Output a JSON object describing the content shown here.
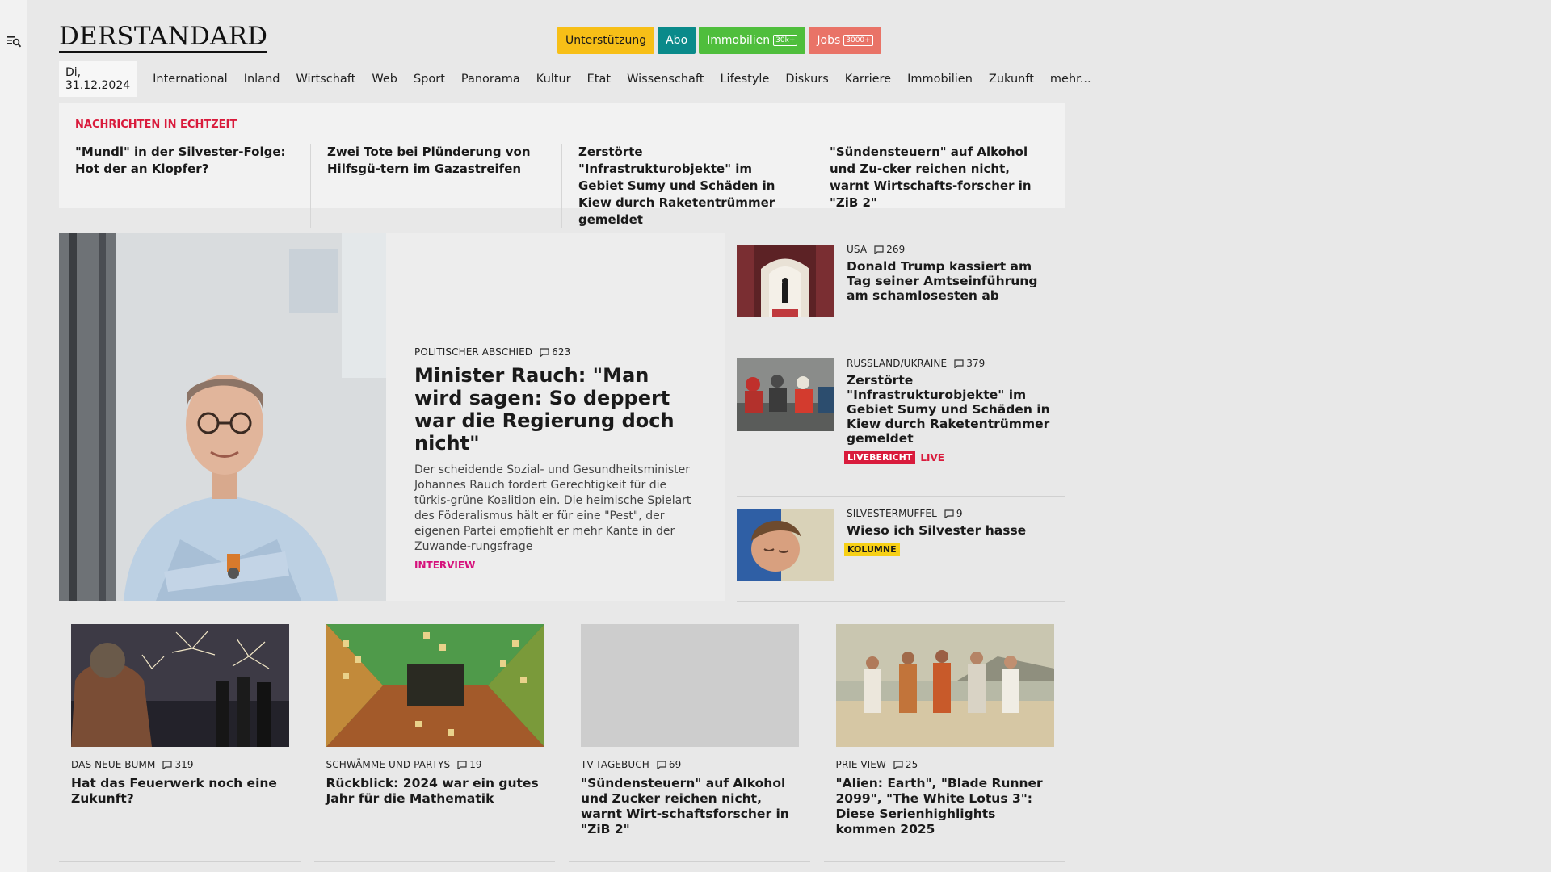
{
  "header": {
    "logo": "DERSTANDARD",
    "buttons": {
      "support": "Unterstützung",
      "abo": "Abo",
      "immo": "Immobilien",
      "immo_badge": "30k+",
      "jobs": "Jobs",
      "jobs_badge": "3000+"
    }
  },
  "nav": {
    "date": "Di, 31.12.2024",
    "items": [
      "International",
      "Inland",
      "Wirtschaft",
      "Web",
      "Sport",
      "Panorama",
      "Kultur",
      "Etat",
      "Wissenschaft",
      "Lifestyle",
      "Diskurs",
      "Karriere",
      "Immobilien",
      "Zukunft",
      "mehr..."
    ]
  },
  "live": {
    "label": "NACHRICHTEN IN ECHTZEIT",
    "items": [
      "\"Mundl\" in der Silvester-Folge: Hot der an Klopfer?",
      "Zwei Tote bei Plünderung von Hilfsgü-tern im Gazastreifen",
      "Zerstörte \"Infrastrukturobjekte\" im Gebiet Sumy und Schäden in Kiew durch Raketentrümmer gemeldet",
      "\"Sündensteuern\" auf Alkohol und Zu-cker reichen nicht, warnt Wirtschafts-forscher in \"ZiB 2\""
    ]
  },
  "hero": {
    "kicker": "Politischer Abschied",
    "comments": "623",
    "title": "Minister Rauch: \"Man wird sagen: So deppert war die Regierung doch nicht\"",
    "lead": "Der scheidende Sozial- und Gesundheitsminister Johannes Rauch fordert Gerechtigkeit für die türkis-grüne Koalition ein. Die heimische Spielart des Föderalismus hält er für eine \"Pest\", der eigenen Partei empfiehlt er mehr Kante in der Zuwande-rungsfrage",
    "tag": "Interview"
  },
  "side": [
    {
      "kicker": "USA",
      "comments": "269",
      "title": "Donald Trump kassiert am Tag seiner Amtseinführung am schamlosesten ab"
    },
    {
      "kicker": "Russland/Ukraine",
      "comments": "379",
      "title": "Zerstörte \"Infrastrukturobjekte\" im Gebiet Sumy und Schäden in Kiew durch Raketentrümmer gemeldet",
      "tag": "Livebericht",
      "live": "Live"
    },
    {
      "kicker": "Silvestermuffel",
      "comments": "9",
      "title": "Wieso ich Silvester hasse",
      "tag": "Kolumne"
    }
  ],
  "cards": [
    {
      "kicker": "Das neue Bumm",
      "comments": "319",
      "title": "Hat das Feuerwerk noch eine Zukunft?"
    },
    {
      "kicker": "Schwämme und Partys",
      "comments": "19",
      "title": "Rückblick: 2024 war ein gutes Jahr für die Mathematik"
    },
    {
      "kicker": "TV-Tagebuch",
      "comments": "69",
      "title": "\"Sündensteuern\" auf Alkohol und Zucker reichen nicht, warnt Wirt-schaftsforscher in \"ZiB 2\""
    },
    {
      "kicker": "Prie-View",
      "comments": "25",
      "title": "\"Alien: Earth\", \"Blade Runner 2099\", \"The White Lotus 3\": Diese Serienhighlights kommen 2025"
    }
  ],
  "colors": {
    "live_red": "#d91b3c",
    "support": "#f7bf17",
    "abo": "#0a8a8a",
    "immo": "#4fbe3c",
    "jobs": "#e97367",
    "interview": "#d6117c"
  },
  "icons": {
    "menu": "menu-search-icon",
    "logo_dropdown": "chevron-down-icon",
    "comments": "speech-bubble-icon"
  }
}
